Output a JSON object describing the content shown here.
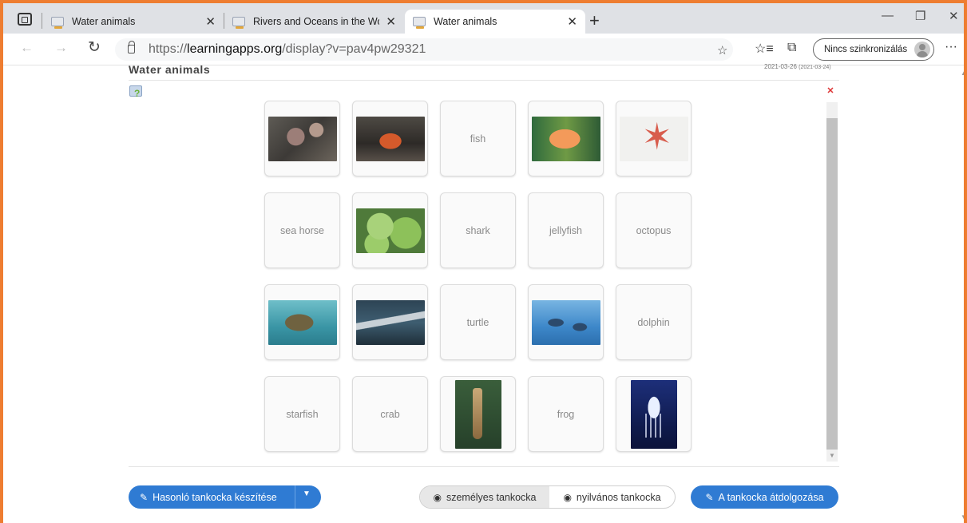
{
  "browser": {
    "tabs": [
      {
        "title": "Water animals",
        "active": false
      },
      {
        "title": "Rivers and Oceans in the World",
        "active": false
      },
      {
        "title": "Water animals",
        "active": true
      }
    ],
    "close_glyph": "✕",
    "new_tab_glyph": "+",
    "url_prefix": "https://",
    "url_host": "learningapps.org",
    "url_path": "/display?v=pav4pw29321",
    "sync_label": "Nincs szinkronizálás",
    "window_controls": {
      "minimize": "—",
      "restore": "❐",
      "close": "✕"
    },
    "icons": {
      "back": "←",
      "forward": "→",
      "refresh": "↻",
      "favorites_add": "☆",
      "favorites": "☆≡",
      "collections": "⧉",
      "more": "···"
    }
  },
  "app": {
    "title": "Water animals",
    "date": "2021-03-26",
    "date_sub": "(2021-03-24)",
    "help_glyph": "?",
    "fullscreen_glyph": "✕"
  },
  "cards": [
    {
      "type": "image",
      "image": "octopus"
    },
    {
      "type": "image",
      "image": "crab"
    },
    {
      "type": "text",
      "label": "fish"
    },
    {
      "type": "image",
      "image": "fish"
    },
    {
      "type": "image",
      "image": "starfish"
    },
    {
      "type": "text",
      "label": "sea horse"
    },
    {
      "type": "image",
      "image": "frog"
    },
    {
      "type": "text",
      "label": "shark"
    },
    {
      "type": "text",
      "label": "jellyfish"
    },
    {
      "type": "text",
      "label": "octopus"
    },
    {
      "type": "image",
      "image": "turtle"
    },
    {
      "type": "image",
      "image": "shark"
    },
    {
      "type": "text",
      "label": "turtle"
    },
    {
      "type": "image",
      "image": "dolphin"
    },
    {
      "type": "text",
      "label": "dolphin"
    },
    {
      "type": "text",
      "label": "starfish"
    },
    {
      "type": "text",
      "label": "crab"
    },
    {
      "type": "image",
      "image": "seahorse"
    },
    {
      "type": "text",
      "label": "frog"
    },
    {
      "type": "image",
      "image": "jellyfish"
    }
  ],
  "footer": {
    "create_similar": "Hasonló tankocka készítése",
    "personal": "személyes tankocka",
    "public": "nyilvános tankocka",
    "edit": "A tankocka átdolgozása",
    "caret": "▼"
  },
  "colors": {
    "frame": "#ee7d31",
    "primary_button": "#2f7bd3"
  }
}
